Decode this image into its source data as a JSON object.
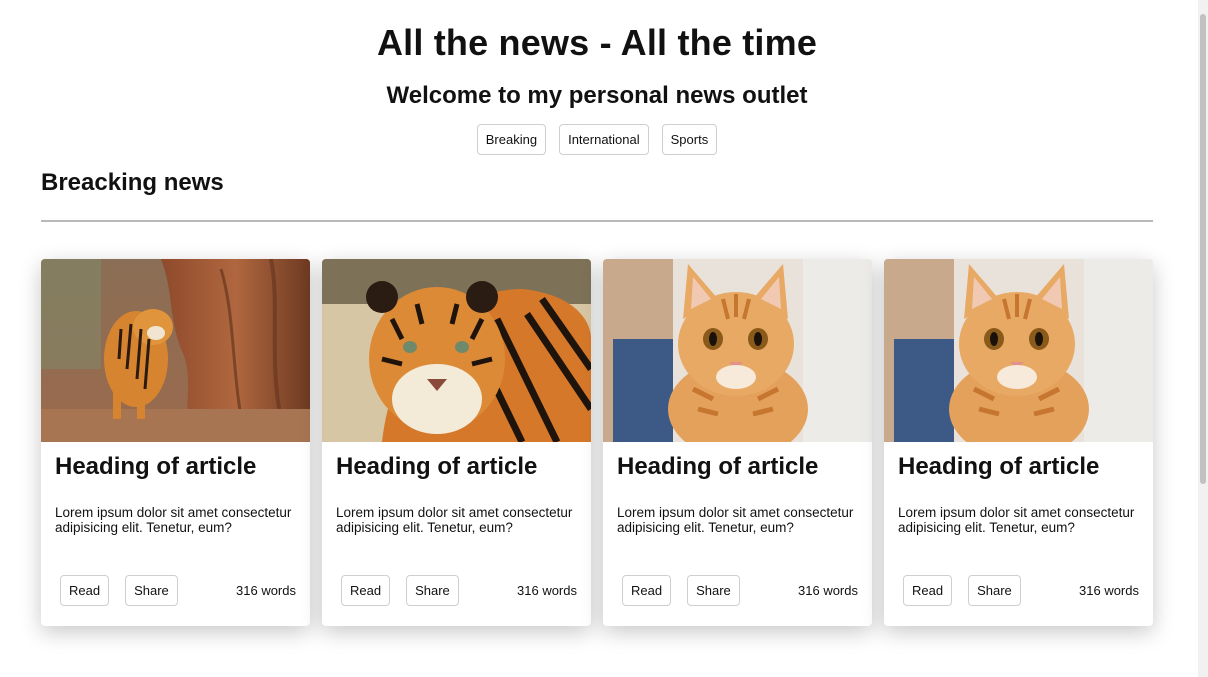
{
  "header": {
    "title": "All the news - All the time",
    "subtitle": "Welcome to my personal news outlet"
  },
  "nav": {
    "buttons": [
      "Breaking",
      "International",
      "Sports"
    ]
  },
  "section": {
    "title": "Breacking news"
  },
  "cards": [
    {
      "image": "tiger-by-tree-photo",
      "heading": "Heading of article",
      "excerpt": "Lorem ipsum dolor sit amet consectetur adipisicing elit. Tenetur, eum?",
      "read_label": "Read",
      "share_label": "Share",
      "word_count": "316 words"
    },
    {
      "image": "tiger-closeup-photo",
      "heading": "Heading of article",
      "excerpt": "Lorem ipsum dolor sit amet consectetur adipisicing elit. Tenetur, eum?",
      "read_label": "Read",
      "share_label": "Share",
      "word_count": "316 words"
    },
    {
      "image": "orange-cat-photo",
      "heading": "Heading of article",
      "excerpt": "Lorem ipsum dolor sit amet consectetur adipisicing elit. Tenetur, eum?",
      "read_label": "Read",
      "share_label": "Share",
      "word_count": "316 words"
    },
    {
      "image": "orange-cat-photo",
      "heading": "Heading of article",
      "excerpt": "Lorem ipsum dolor sit amet consectetur adipisicing elit. Tenetur, eum?",
      "read_label": "Read",
      "share_label": "Share",
      "word_count": "316 words"
    }
  ]
}
